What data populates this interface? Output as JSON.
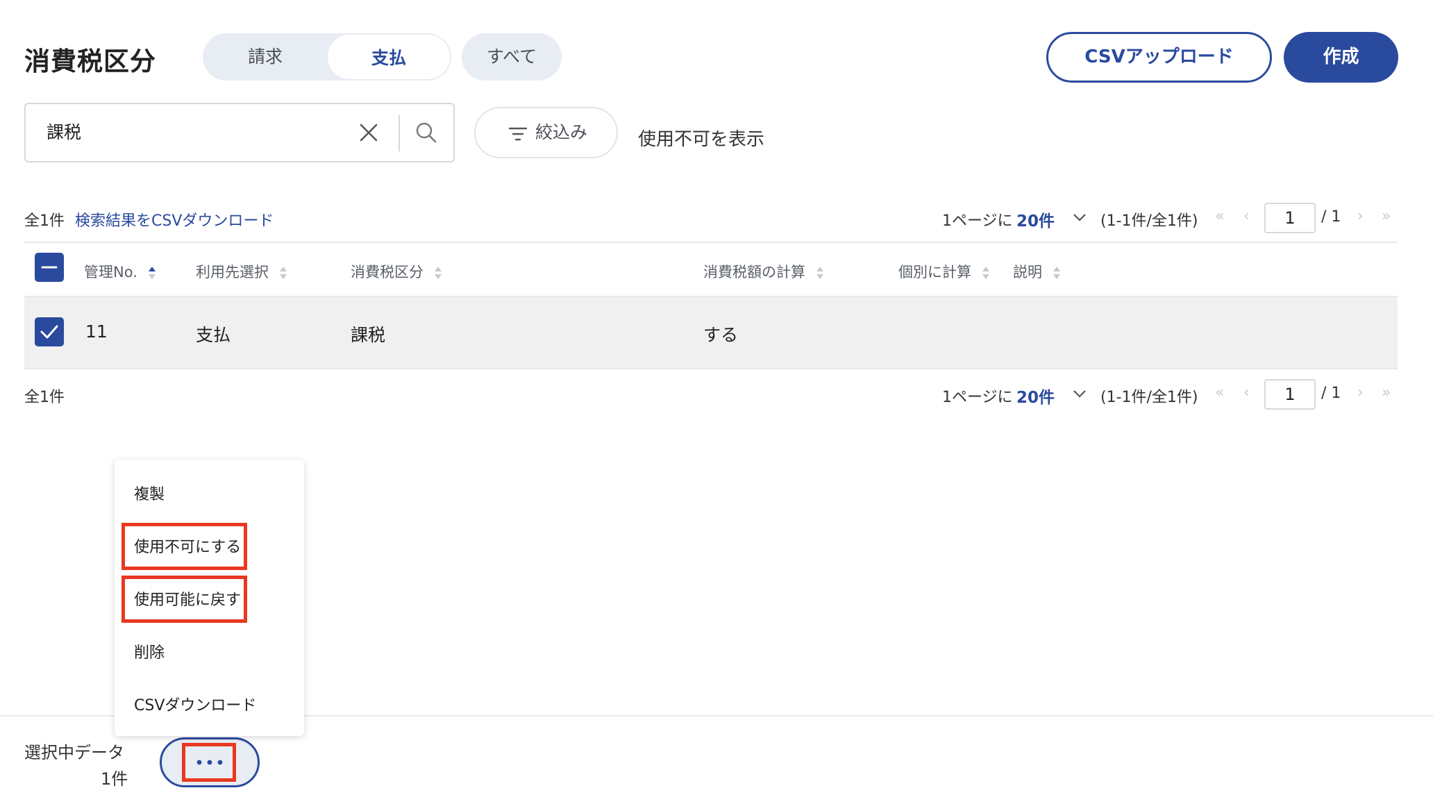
{
  "header": {
    "title": "消費税区分",
    "tabs": [
      {
        "label": "請求",
        "active": false
      },
      {
        "label": "支払",
        "active": true
      },
      {
        "label": "すべて",
        "active": false
      }
    ],
    "csv_upload_label": "CSVアップロード",
    "create_label": "作成"
  },
  "search": {
    "value": "課税",
    "filter_label": "絞込み",
    "show_disabled_label": "使用不可を表示"
  },
  "toolbar": {
    "total": "全1件",
    "csv_download_link": "検索結果をCSVダウンロード",
    "per_page_label": "1ページに",
    "per_page_value": "20件",
    "range": "(1-1件/全1件)",
    "page_current": "1",
    "page_total": "/ 1"
  },
  "table": {
    "columns": [
      "管理No.",
      "利用先選択",
      "消費税区分",
      "消費税額の計算",
      "個別に計算",
      "説明"
    ],
    "rows": [
      {
        "no": "11",
        "usage": "支払",
        "category": "課税",
        "calc": "する",
        "individual": "",
        "description": "",
        "selected": true
      }
    ]
  },
  "menu": {
    "items": [
      "複製",
      "使用不可にする",
      "使用可能に戻す",
      "削除",
      "CSVダウンロード"
    ]
  },
  "footer": {
    "selected_label": "選択中データ",
    "selected_count": "1件",
    "more_icon": "ellipsis-icon"
  },
  "colors": {
    "primary": "#2a4a9e",
    "highlight": "#e8381f",
    "row_bg": "#f0f0f0"
  }
}
